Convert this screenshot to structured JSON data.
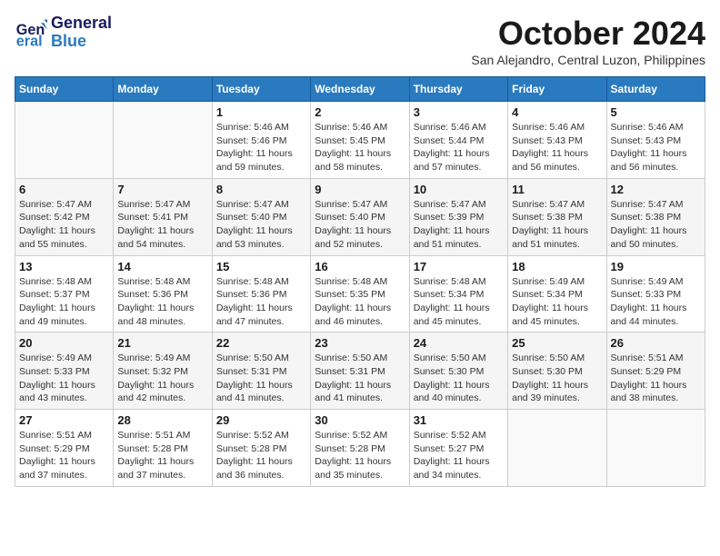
{
  "header": {
    "logo": {
      "line1": "General",
      "line2": "Blue"
    },
    "title": "October 2024",
    "subtitle": "San Alejandro, Central Luzon, Philippines"
  },
  "weekdays": [
    "Sunday",
    "Monday",
    "Tuesday",
    "Wednesday",
    "Thursday",
    "Friday",
    "Saturday"
  ],
  "weeks": [
    [
      {
        "day": null
      },
      {
        "day": null
      },
      {
        "day": 1,
        "sunrise": "5:46 AM",
        "sunset": "5:46 PM",
        "daylight": "11 hours and 59 minutes."
      },
      {
        "day": 2,
        "sunrise": "5:46 AM",
        "sunset": "5:45 PM",
        "daylight": "11 hours and 58 minutes."
      },
      {
        "day": 3,
        "sunrise": "5:46 AM",
        "sunset": "5:44 PM",
        "daylight": "11 hours and 57 minutes."
      },
      {
        "day": 4,
        "sunrise": "5:46 AM",
        "sunset": "5:43 PM",
        "daylight": "11 hours and 56 minutes."
      },
      {
        "day": 5,
        "sunrise": "5:46 AM",
        "sunset": "5:43 PM",
        "daylight": "11 hours and 56 minutes."
      }
    ],
    [
      {
        "day": 6,
        "sunrise": "5:47 AM",
        "sunset": "5:42 PM",
        "daylight": "11 hours and 55 minutes."
      },
      {
        "day": 7,
        "sunrise": "5:47 AM",
        "sunset": "5:41 PM",
        "daylight": "11 hours and 54 minutes."
      },
      {
        "day": 8,
        "sunrise": "5:47 AM",
        "sunset": "5:40 PM",
        "daylight": "11 hours and 53 minutes."
      },
      {
        "day": 9,
        "sunrise": "5:47 AM",
        "sunset": "5:40 PM",
        "daylight": "11 hours and 52 minutes."
      },
      {
        "day": 10,
        "sunrise": "5:47 AM",
        "sunset": "5:39 PM",
        "daylight": "11 hours and 51 minutes."
      },
      {
        "day": 11,
        "sunrise": "5:47 AM",
        "sunset": "5:38 PM",
        "daylight": "11 hours and 51 minutes."
      },
      {
        "day": 12,
        "sunrise": "5:47 AM",
        "sunset": "5:38 PM",
        "daylight": "11 hours and 50 minutes."
      }
    ],
    [
      {
        "day": 13,
        "sunrise": "5:48 AM",
        "sunset": "5:37 PM",
        "daylight": "11 hours and 49 minutes."
      },
      {
        "day": 14,
        "sunrise": "5:48 AM",
        "sunset": "5:36 PM",
        "daylight": "11 hours and 48 minutes."
      },
      {
        "day": 15,
        "sunrise": "5:48 AM",
        "sunset": "5:36 PM",
        "daylight": "11 hours and 47 minutes."
      },
      {
        "day": 16,
        "sunrise": "5:48 AM",
        "sunset": "5:35 PM",
        "daylight": "11 hours and 46 minutes."
      },
      {
        "day": 17,
        "sunrise": "5:48 AM",
        "sunset": "5:34 PM",
        "daylight": "11 hours and 45 minutes."
      },
      {
        "day": 18,
        "sunrise": "5:49 AM",
        "sunset": "5:34 PM",
        "daylight": "11 hours and 45 minutes."
      },
      {
        "day": 19,
        "sunrise": "5:49 AM",
        "sunset": "5:33 PM",
        "daylight": "11 hours and 44 minutes."
      }
    ],
    [
      {
        "day": 20,
        "sunrise": "5:49 AM",
        "sunset": "5:33 PM",
        "daylight": "11 hours and 43 minutes."
      },
      {
        "day": 21,
        "sunrise": "5:49 AM",
        "sunset": "5:32 PM",
        "daylight": "11 hours and 42 minutes."
      },
      {
        "day": 22,
        "sunrise": "5:50 AM",
        "sunset": "5:31 PM",
        "daylight": "11 hours and 41 minutes."
      },
      {
        "day": 23,
        "sunrise": "5:50 AM",
        "sunset": "5:31 PM",
        "daylight": "11 hours and 41 minutes."
      },
      {
        "day": 24,
        "sunrise": "5:50 AM",
        "sunset": "5:30 PM",
        "daylight": "11 hours and 40 minutes."
      },
      {
        "day": 25,
        "sunrise": "5:50 AM",
        "sunset": "5:30 PM",
        "daylight": "11 hours and 39 minutes."
      },
      {
        "day": 26,
        "sunrise": "5:51 AM",
        "sunset": "5:29 PM",
        "daylight": "11 hours and 38 minutes."
      }
    ],
    [
      {
        "day": 27,
        "sunrise": "5:51 AM",
        "sunset": "5:29 PM",
        "daylight": "11 hours and 37 minutes."
      },
      {
        "day": 28,
        "sunrise": "5:51 AM",
        "sunset": "5:28 PM",
        "daylight": "11 hours and 37 minutes."
      },
      {
        "day": 29,
        "sunrise": "5:52 AM",
        "sunset": "5:28 PM",
        "daylight": "11 hours and 36 minutes."
      },
      {
        "day": 30,
        "sunrise": "5:52 AM",
        "sunset": "5:28 PM",
        "daylight": "11 hours and 35 minutes."
      },
      {
        "day": 31,
        "sunrise": "5:52 AM",
        "sunset": "5:27 PM",
        "daylight": "11 hours and 34 minutes."
      },
      {
        "day": null
      },
      {
        "day": null
      }
    ]
  ]
}
